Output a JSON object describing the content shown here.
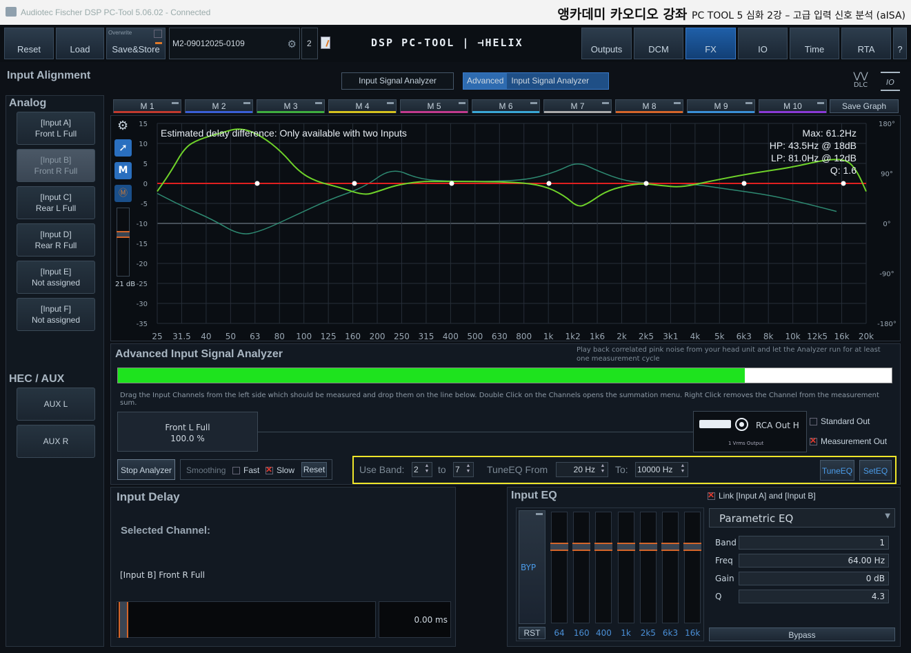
{
  "window": {
    "app_title": "Audiotec Fischer DSP PC-Tool 5.06.02 - Connected",
    "lecture_title": "앵카데미 카오디오 강좌",
    "lecture_subtitle": "PC TOOL 5 심화 2강 – 고급 입력 신호 분석 (aISA)"
  },
  "toolbar": {
    "reset": "Reset",
    "load": "Load",
    "overwrite": "Overwrite",
    "save_store": "Save&Store",
    "preset_name": "M2-09012025-0109",
    "preset_number": "2",
    "logo": "DSP PC-TOOL | ⊣HELIX",
    "outputs": "Outputs",
    "dcm": "DCM",
    "fx": "FX",
    "io": "IO",
    "time": "Time",
    "rta": "RTA",
    "help": "?"
  },
  "left": {
    "section_title": "Input Alignment",
    "analog_title": "Analog",
    "inputs": [
      {
        "line1": "[Input A]",
        "line2": "Front L Full"
      },
      {
        "line1": "[Input B]",
        "line2": "Front R Full"
      },
      {
        "line1": "[Input C]",
        "line2": "Rear L Full"
      },
      {
        "line1": "[Input D]",
        "line2": "Rear R Full"
      },
      {
        "line1": "[Input E]",
        "line2": "Not assigned"
      },
      {
        "line1": "[Input F]",
        "line2": "Not assigned"
      }
    ],
    "hec_title": "HEC / AUX",
    "aux": [
      "AUX L",
      "AUX R"
    ]
  },
  "top_tabs": {
    "isa": "Input Signal Analyzer",
    "adv_prefix": "Advanced",
    "adv": "Input Signal Analyzer",
    "dlc": "DLC",
    "io_icon": "IO"
  },
  "memory_tabs": [
    "M 1",
    "M 2",
    "M 3",
    "M 4",
    "M 5",
    "M 6",
    "M 7",
    "M 8",
    "M 9",
    "M 10"
  ],
  "memory_colors": [
    "#c23a2e",
    "#3a5fd6",
    "#3fae3f",
    "#d4c21e",
    "#c23a8e",
    "#3aa8d6",
    "#aaaaaa",
    "#d4652a",
    "#3a8fd6",
    "#8a3ad6"
  ],
  "save_graph": "Save Graph",
  "graph": {
    "delay_text": "Estimated delay difference: Only available with two Inputs",
    "info": [
      "Max: 61.2Hz",
      "HP: 43.5Hz @ 18dB",
      "LP: 81.0Hz @ 12dB",
      "Q: 1.6"
    ],
    "db_scale": "21 dB",
    "m_button": "M",
    "y_ticks": [
      "15",
      "10",
      "5",
      "0",
      "-5",
      "-10",
      "-15",
      "-20",
      "-25",
      "-30",
      "-35"
    ],
    "phase_ticks": [
      "180°",
      "90°",
      "0°",
      "-90°",
      "-180°"
    ],
    "x_ticks": [
      "25",
      "31.5",
      "40",
      "50",
      "63",
      "80",
      "100",
      "125",
      "160",
      "200",
      "250",
      "315",
      "400",
      "500",
      "630",
      "800",
      "1k",
      "1k2",
      "1k6",
      "2k",
      "2k5",
      "3k1",
      "4k",
      "5k",
      "6k3",
      "8k",
      "10k",
      "12k5",
      "16k",
      "20k"
    ],
    "colors": {
      "magnitude": "#6fd32a",
      "phase": "#2e8a72",
      "zero_line": "#e02020"
    }
  },
  "analyzer": {
    "title": "Advanced Input Signal Analyzer",
    "hint": "Play back correlated pink noise from your head unit and let the Analyzer run for at least one measurement cycle",
    "progress": 0.81,
    "instructions": "Drag the Input Channels from the left side which should be measured and drop them on the line below. Double Click on the Channels opens the summation menu. Right Click removes the Channel from the measurement sum.",
    "channel_name": "Front L Full",
    "channel_pct": "100.0 %",
    "rca_label": "RCA Out H",
    "rca_sub": "1 Vrms Output",
    "standard_out": "Standard Out",
    "measurement_out": "Measurement Out",
    "stop": "Stop Analyzer",
    "smoothing": "Smoothing",
    "fast": "Fast",
    "slow": "Slow",
    "reset": "Reset",
    "use_band": "Use Band:",
    "band_from": "2",
    "to": "to",
    "band_to": "7",
    "tuneeq_from": "TuneEQ From",
    "from_hz": "20 Hz",
    "to_label": "To:",
    "to_hz": "10000 Hz",
    "tuneeq": "TuneEQ",
    "seteq": "SetEQ"
  },
  "delay": {
    "title": "Input Delay",
    "selected": "Selected Channel:",
    "channel": "[Input B] Front R Full",
    "value": "0.00 ms"
  },
  "eq": {
    "title": "Input EQ",
    "link": "Link [Input A] and [Input B]",
    "byp": "BYP",
    "rst": "RST",
    "bands": [
      "64",
      "160",
      "400",
      "1k",
      "2k5",
      "6k3",
      "16k"
    ],
    "type": "Parametric EQ",
    "band_label": "Band",
    "band": "1",
    "freq_label": "Freq",
    "freq": "64.00 Hz",
    "gain_label": "Gain",
    "gain": "0 dB",
    "q_label": "Q",
    "q": "4.3",
    "bypass": "Bypass"
  }
}
